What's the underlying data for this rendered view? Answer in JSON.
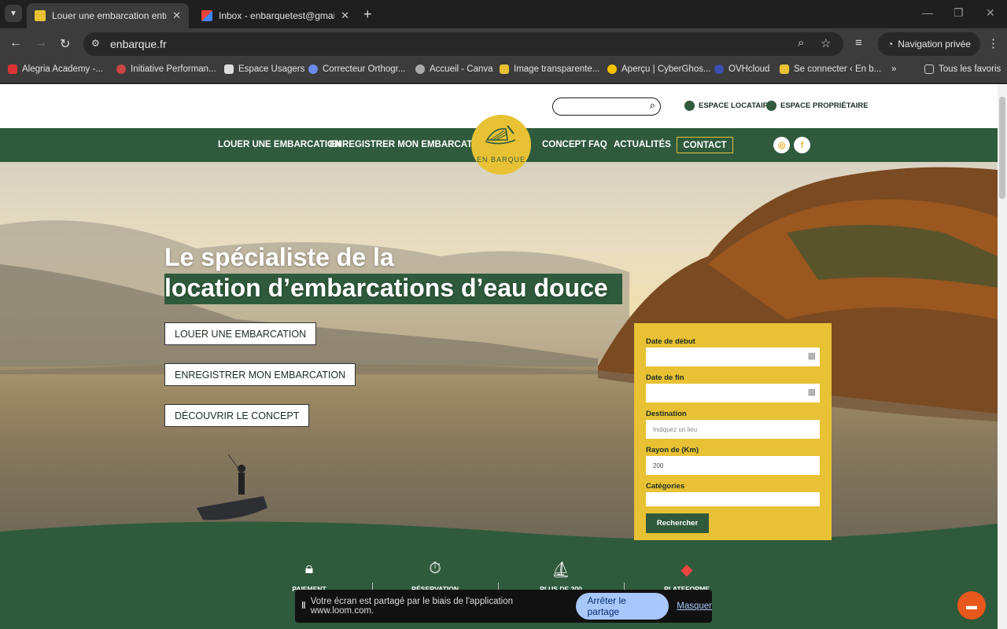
{
  "browser": {
    "tabs": [
      {
        "title": "Louer une embarcation entre pa",
        "icon": "enbarque-favicon",
        "active": true
      },
      {
        "title": "Inbox - enbarquetest@gmail.co",
        "icon": "gmail-icon",
        "active": false
      }
    ],
    "url": "enbarque.fr",
    "private_label": "Navigation privée",
    "bookmarks": [
      "Alegria Academy -...",
      "Initiative Performan...",
      "Espace Usagers",
      "Correcteur Orthogr...",
      "Accueil - Canva",
      "Image transparente...",
      "Aperçu | CyberGhos...",
      "OVHcloud",
      "Se connecter ‹ En b..."
    ],
    "all_bookmarks": "Tous les favoris"
  },
  "site": {
    "espace_locataire": "ESPACE LOCATAIRE",
    "espace_proprietaire": "ESPACE PROPRIÉTAIRE",
    "nav": {
      "louer": "LOUER UNE EMBARCATION",
      "enregistrer": "ENREGISTRER MON EMBARCATION",
      "concept": "CONCEPT",
      "faq": "FAQ",
      "actualites": "ACTUALITÉS",
      "contact": "CONTACT"
    },
    "logo_text": "EN BARQUE",
    "social": {
      "instagram": "◎",
      "facebook": "f"
    },
    "hero": {
      "title_line1": "Le spécialiste de la",
      "title_line2": "location d’embarcations d’eau douce",
      "btn_louer": "LOUER UNE EMBARCATION",
      "btn_enregistrer": "ENREGISTRER MON EMBARCATION",
      "btn_concept": "DÉCOUVRIR LE CONCEPT"
    },
    "form": {
      "date_debut_label": "Date de début",
      "date_fin_label": "Date de fin",
      "destination_label": "Destination",
      "destination_placeholder": "Indiquez un lieu",
      "rayon_label": "Rayon de (Km)",
      "rayon_value": "200",
      "categories_label": "Catégories",
      "submit": "Rechercher"
    },
    "features": [
      {
        "icon": "lock-icon",
        "label": "PAIEMENT"
      },
      {
        "icon": "stopwatch-icon",
        "label": "RÉSERVATION"
      },
      {
        "icon": "boat-icon",
        "label": "PLUS DE 200"
      },
      {
        "icon": "france-map-icon",
        "label": "PLATEFORME"
      }
    ]
  },
  "share_bar": {
    "message": "Votre écran est partagé par le biais de l'application www.loom.com.",
    "stop": "Arrêter le partage",
    "hide": "Masquer"
  },
  "colors": {
    "green": "#2f5a3c",
    "yellow": "#e8c234"
  }
}
